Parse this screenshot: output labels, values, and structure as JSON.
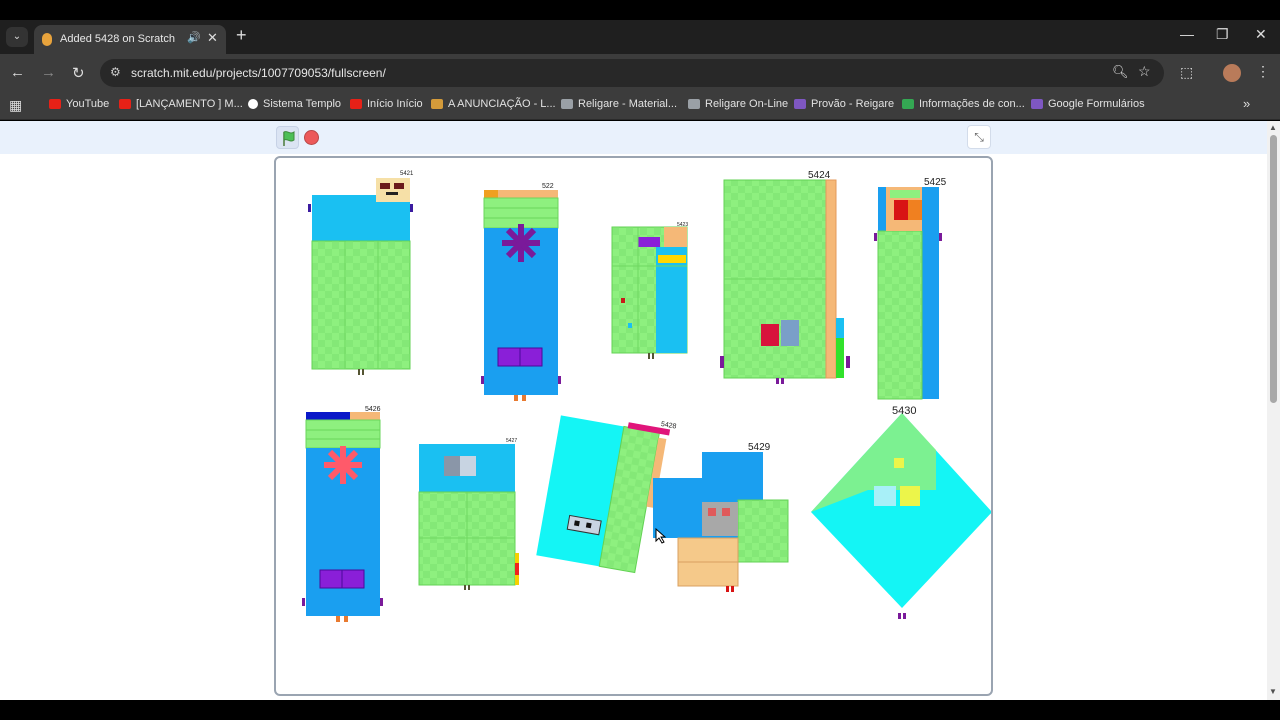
{
  "tab": {
    "title": "Added 5428 on Scratch",
    "close_label": "✕",
    "new_tab_label": "+"
  },
  "address": {
    "url": "scratch.mit.edu/projects/1007709053/fullscreen/"
  },
  "bookmarks": [
    {
      "label": "YouTube",
      "color": "#e62117"
    },
    {
      "label": "[LANÇAMENTO ] M...",
      "color": "#e62117"
    },
    {
      "label": "Sistema Templo",
      "color": "#ffffff"
    },
    {
      "label": "Início Início",
      "color": "#e62117"
    },
    {
      "label": "A ANUNCIAÇÃO - L...",
      "color": "#d49b3a"
    },
    {
      "label": "Religare - Material...",
      "color": "#9aa0a6"
    },
    {
      "label": "Religare On-Line",
      "color": "#9aa0a6"
    },
    {
      "label": "Provão - Reigare",
      "color": "#7e57c2"
    },
    {
      "label": "Informações de con...",
      "color": "#34a853"
    },
    {
      "label": "Google Formulários",
      "color": "#7e57c2"
    }
  ],
  "stage": {
    "labels": [
      "5421",
      "522",
      "5423",
      "5424",
      "5425",
      "5426",
      "5427",
      "5428",
      "5429",
      "5430"
    ]
  },
  "colors": {
    "green": "#8ef07f",
    "blue": "#1a9ff0",
    "cyan": "#14f5f5",
    "purple": "#8a1fd8"
  }
}
